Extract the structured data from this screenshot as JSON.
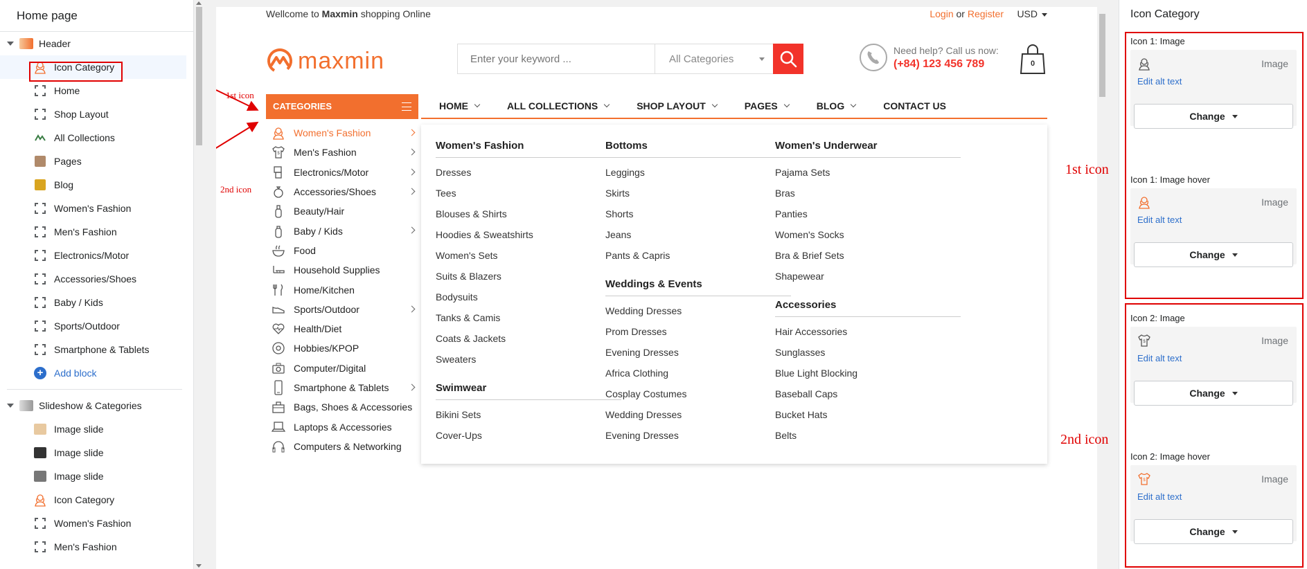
{
  "editor": {
    "page_title": "Home page",
    "groups": [
      {
        "label": "Header",
        "items": [
          "Icon Category",
          "Home",
          "Shop Layout",
          "All Collections",
          "Pages",
          "Blog",
          "Women's Fashion",
          "Men's Fashion",
          "Electronics/Motor",
          "Accessories/Shoes",
          "Baby / Kids",
          "Sports/Outdoor",
          "Smartphone & Tablets"
        ],
        "add_block": "Add block"
      },
      {
        "label": "Slideshow & Categories",
        "items": [
          "Image slide",
          "Image slide",
          "Image slide",
          "Icon Category",
          "Women's Fashion",
          "Men's Fashion"
        ]
      }
    ]
  },
  "store": {
    "welcome_prefix": "Wellcome to",
    "welcome_brand": "Maxmin",
    "welcome_suffix": "shopping Online",
    "login": "Login",
    "or": "or",
    "register": "Register",
    "currency": "USD",
    "logo_text": "maxmin",
    "search_placeholder": "Enter your keyword ...",
    "search_category": "All Categories",
    "help_line": "Need help? Call us now:",
    "phone": "(+84) 123 456 789",
    "cart_count": "0",
    "categories_label": "CATEGORIES",
    "nav": [
      "HOME",
      "ALL COLLECTIONS",
      "SHOP LAYOUT",
      "PAGES",
      "BLOG",
      "CONTACT US"
    ],
    "categories": [
      {
        "label": "Women's Fashion",
        "arrow": true
      },
      {
        "label": "Men's Fashion",
        "arrow": true
      },
      {
        "label": "Electronics/Motor",
        "arrow": true
      },
      {
        "label": "Accessories/Shoes",
        "arrow": true
      },
      {
        "label": "Beauty/Hair",
        "arrow": false
      },
      {
        "label": "Baby / Kids",
        "arrow": true
      },
      {
        "label": "Food",
        "arrow": false
      },
      {
        "label": "Household Supplies",
        "arrow": false
      },
      {
        "label": "Home/Kitchen",
        "arrow": false
      },
      {
        "label": "Sports/Outdoor",
        "arrow": true
      },
      {
        "label": "Health/Diet",
        "arrow": false
      },
      {
        "label": "Hobbies/KPOP",
        "arrow": false
      },
      {
        "label": "Computer/Digital",
        "arrow": false
      },
      {
        "label": "Smartphone & Tablets",
        "arrow": true
      },
      {
        "label": "Bags, Shoes & Accessories",
        "arrow": false
      },
      {
        "label": "Laptops & Accessories",
        "arrow": false
      },
      {
        "label": "Computers & Networking",
        "arrow": false
      }
    ],
    "mega_menu": [
      [
        {
          "heading": "Women's Fashion",
          "links": [
            "Dresses",
            "Tees",
            "Blouses & Shirts",
            "Hoodies & Sweatshirts",
            "Women's Sets",
            "Suits & Blazers",
            "Bodysuits",
            "Tanks & Camis",
            "Coats & Jackets",
            "Sweaters"
          ]
        },
        {
          "heading": "Swimwear",
          "links": [
            "Bikini Sets",
            "Cover-Ups"
          ]
        }
      ],
      [
        {
          "heading": "Bottoms",
          "links": [
            "Leggings",
            "Skirts",
            "Shorts",
            "Jeans",
            "Pants & Capris"
          ]
        },
        {
          "heading": "Weddings & Events",
          "links": [
            "Wedding Dresses",
            "Prom Dresses",
            "Evening Dresses",
            "Africa Clothing",
            "Cosplay Costumes",
            "Wedding Dresses",
            "Evening Dresses"
          ]
        }
      ],
      [
        {
          "heading": "Women's Underwear",
          "links": [
            "Pajama Sets",
            "Bras",
            "Panties",
            "Women's Socks",
            "Bra & Brief Sets",
            "Shapewear"
          ]
        },
        {
          "heading": "Accessories",
          "links": [
            "Hair Accessories",
            "Sunglasses",
            "Blue Light Blocking",
            "Baseball Caps",
            "Bucket Hats",
            "Belts"
          ]
        }
      ]
    ]
  },
  "annotations": {
    "first_icon_small": "1st icon",
    "second_icon_small": "2nd icon",
    "first_icon_big": "1st icon",
    "second_icon_big": "2nd icon"
  },
  "settings": {
    "title": "Icon Category",
    "fields": [
      {
        "label": "Icon 1: Image",
        "image_text": "Image",
        "alt_text": "Edit alt text",
        "change": "Change",
        "icon": "woman-icon",
        "hover": false
      },
      {
        "label": "Icon 1: Image hover",
        "image_text": "Image",
        "alt_text": "Edit alt text",
        "change": "Change",
        "icon": "woman-icon",
        "hover": true
      },
      {
        "label": "Icon 2: Image",
        "image_text": "Image",
        "alt_text": "Edit alt text",
        "change": "Change",
        "icon": "shirt-icon",
        "hover": false
      },
      {
        "label": "Icon 2: Image hover",
        "image_text": "Image",
        "alt_text": "Edit alt text",
        "change": "Change",
        "icon": "shirt-icon",
        "hover": true
      }
    ]
  },
  "colors": {
    "accent": "#f26f2e",
    "search_button": "#f2332a",
    "annotation": "#e00000",
    "link": "#2c6ecb"
  }
}
